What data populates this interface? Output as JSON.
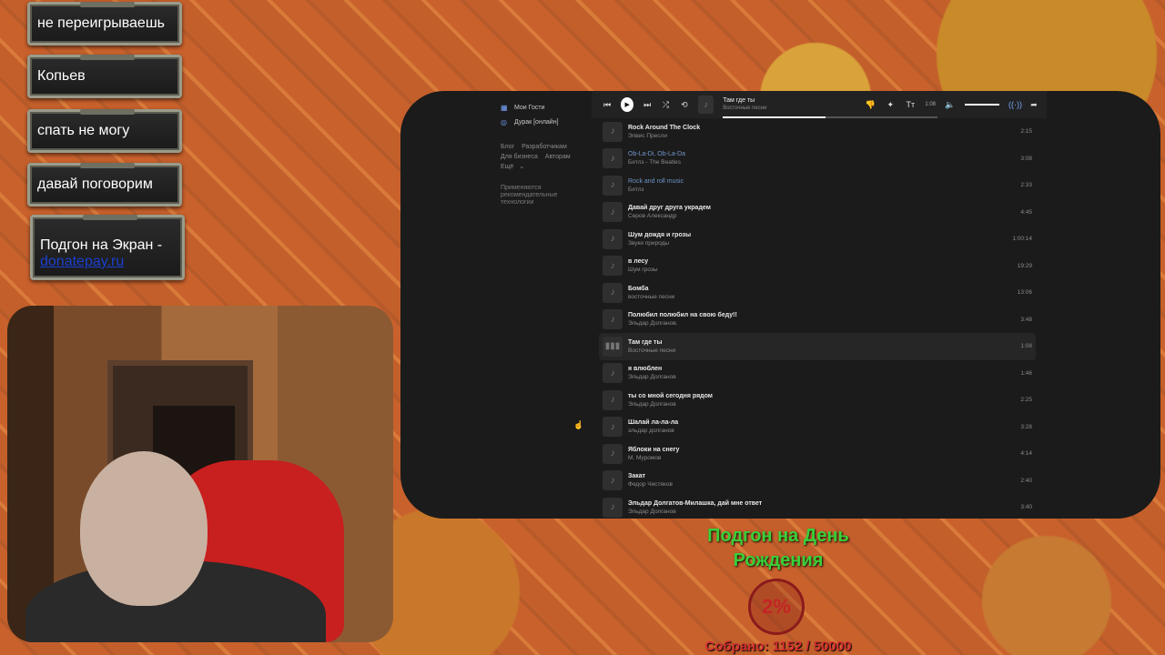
{
  "chat_messages": [
    "не переигрываешь",
    "Копьев",
    "спать не могу",
    "давай поговорим",
    "Подгон на Экран -"
  ],
  "chat_link": "donatepay.ru",
  "sidebar": {
    "items": [
      "Мои Гости",
      "Дурак [онлайн]"
    ],
    "links": [
      "Блог",
      "Разработчикам",
      "Для бизнеса",
      "Авторам",
      "Ещё"
    ],
    "note": "Применяются рекомендательные технологии"
  },
  "player": {
    "title": "Там где ты",
    "artist": "Восточные песни",
    "time": "1:08",
    "progress": 0.48
  },
  "tracks": [
    {
      "title": "Rock Around The Clock",
      "artist": "Элвис Пресли",
      "duration": "2:15",
      "blue": false
    },
    {
      "title": "Ob-La-Di, Ob-La-Da",
      "artist": "Битлз - The Beatles",
      "duration": "3:08",
      "blue": true
    },
    {
      "title": "Rock and roll music",
      "artist": "Битлз",
      "duration": "2:33",
      "blue": true
    },
    {
      "title": "Давай друг друга украдем",
      "artist": "Серов Александр",
      "duration": "4:45",
      "blue": false
    },
    {
      "title": "Шум дождя и грозы",
      "artist": "Звуки природы",
      "duration": "1:00:14",
      "blue": false
    },
    {
      "title": "в лесу",
      "artist": "Шум грозы",
      "duration": "19:29",
      "blue": false
    },
    {
      "title": "Бомба",
      "artist": "восточные песни",
      "duration": "13:06",
      "blue": false
    },
    {
      "title": "Полюбил полюбил на свою беду!!",
      "artist": "Эльдар Долганов.",
      "duration": "3:48",
      "blue": false
    },
    {
      "title": "Там где ты",
      "artist": "Восточные песни",
      "duration": "1:08",
      "blue": false,
      "active": true
    },
    {
      "title": "я влюблен",
      "artist": "Эльдар Долганов",
      "duration": "1:46",
      "blue": false
    },
    {
      "title": "ты со мной сегодня рядом",
      "artist": "Эльдар Долганов",
      "duration": "2:25",
      "blue": false
    },
    {
      "title": "Шалай ла-ла-ла",
      "artist": "эльдар долганов",
      "duration": "3:28",
      "blue": false
    },
    {
      "title": "Яблоки на снегу",
      "artist": "М. Муромов",
      "duration": "4:14",
      "blue": false
    },
    {
      "title": "Закат",
      "artist": "Федор Чистяков",
      "duration": "2:40",
      "blue": false
    },
    {
      "title": "Эльдар Долгатов-Милашка, дай мне ответ",
      "artist": "Эльдар Долганов",
      "duration": "3:40",
      "blue": false
    }
  ],
  "donation": {
    "title": "Подгон на День Рождения",
    "percent": "2%",
    "collected": "Собрано: 1152 / 50000"
  }
}
